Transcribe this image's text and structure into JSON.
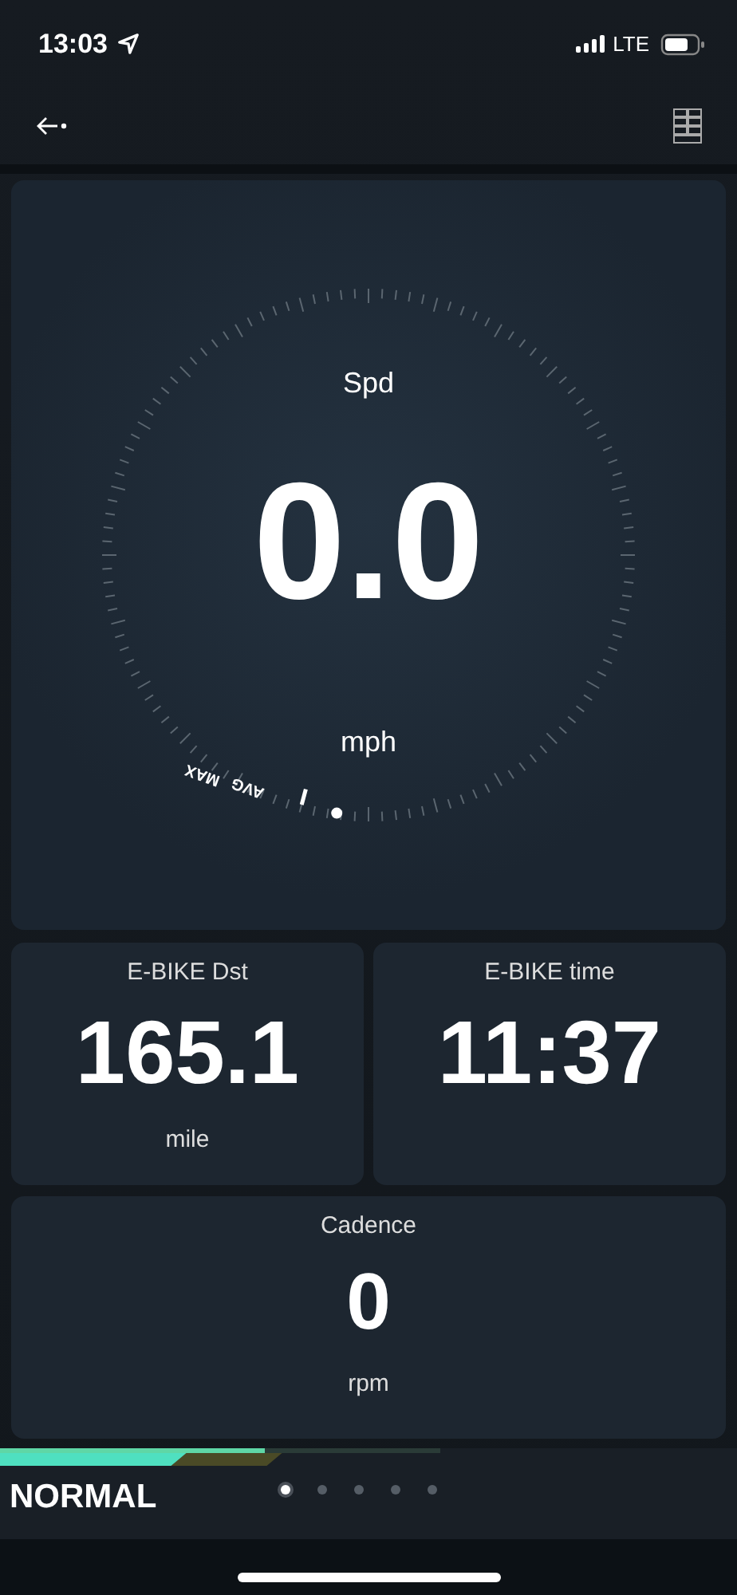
{
  "status_bar": {
    "time": "13:03",
    "network": "LTE"
  },
  "speed": {
    "label": "Spd",
    "value": "0.0",
    "unit": "mph",
    "markers": [
      "MAX",
      "AVG"
    ]
  },
  "tiles": [
    {
      "label": "E-BIKE Dst",
      "value": "165.1",
      "unit": "mile"
    },
    {
      "label": "E-BIKE time",
      "value": "11:37"
    }
  ],
  "cadence": {
    "label": "Cadence",
    "value": "0",
    "unit": "rpm"
  },
  "assist": {
    "mode": "NORMAL",
    "level": 0.6,
    "blocks": [
      {
        "on": true
      },
      {
        "on": true
      },
      {
        "on": false
      }
    ]
  },
  "pages": [
    {
      "selected": true
    },
    {
      "selected": false
    },
    {
      "selected": false
    },
    {
      "selected": false
    },
    {
      "selected": false
    }
  ]
}
